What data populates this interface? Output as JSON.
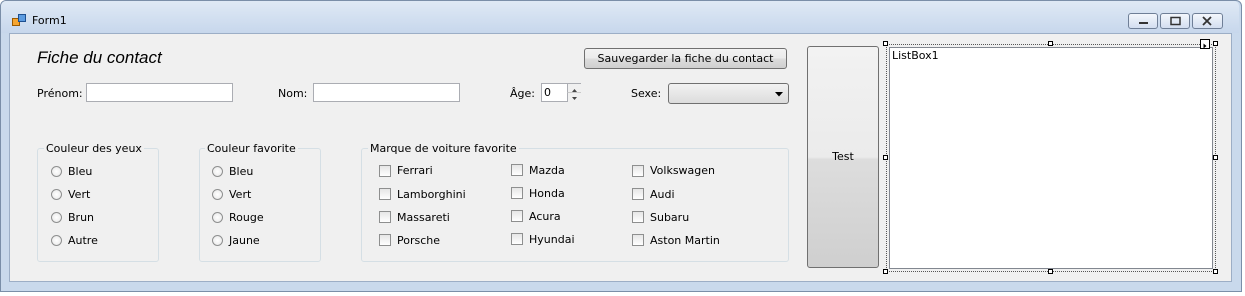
{
  "window": {
    "title": "Form1"
  },
  "heading": "Fiche du contact",
  "save_button_label": "Sauvegarder la fiche du contact",
  "prenom": {
    "label": "Prénom:",
    "value": ""
  },
  "nom": {
    "label": "Nom:",
    "value": ""
  },
  "age": {
    "label": "Âge:",
    "value": "0"
  },
  "sexe": {
    "label": "Sexe:",
    "value": ""
  },
  "eye_color_group": {
    "title": "Couleur des yeux",
    "options": [
      "Bleu",
      "Vert",
      "Brun",
      "Autre"
    ]
  },
  "fav_color_group": {
    "title": "Couleur favorite",
    "options": [
      "Bleu",
      "Vert",
      "Rouge",
      "Jaune"
    ]
  },
  "car_brand_group": {
    "title": "Marque de voiture favorite",
    "options": [
      "Ferrari",
      "Lamborghini",
      "Massareti",
      "Porsche",
      "Mazda",
      "Honda",
      "Acura",
      "Hyundai",
      "Volkswagen",
      "Audi",
      "Subaru",
      "Aston Martin"
    ]
  },
  "test_button_label": "Test",
  "listbox": {
    "label": "ListBox1"
  },
  "icons": {
    "app": "form-app-icon",
    "minimize": "minimize-icon",
    "maximize": "maximize-icon",
    "close": "close-icon",
    "dropdown": "chevron-down-icon",
    "spin_up": "spin-up-icon",
    "spin_down": "spin-down-icon",
    "smart_tag": "smart-tag-arrow-icon"
  }
}
